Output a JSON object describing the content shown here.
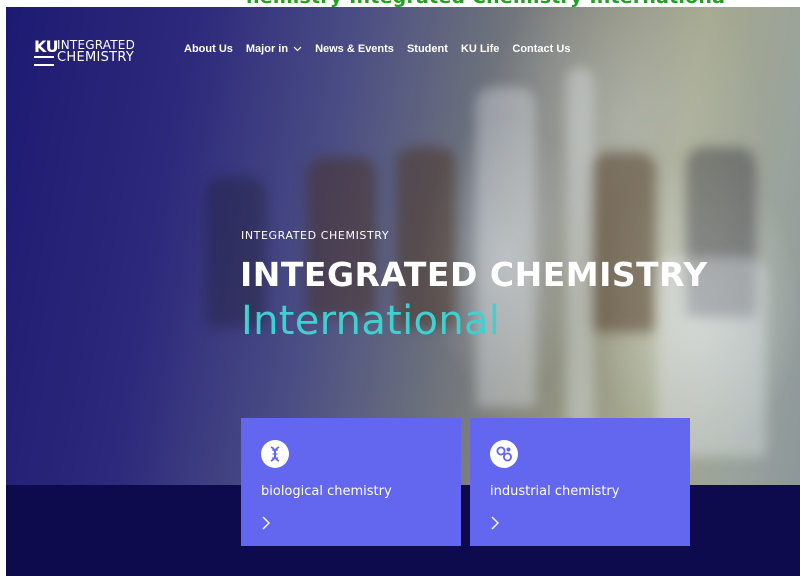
{
  "overlay": {
    "text": "hemistry Integrated Chemistry Internationa"
  },
  "logo": {
    "ku": "KU",
    "line1": "INTEGRATED",
    "line2": "CHEMISTRY"
  },
  "nav": {
    "items": [
      {
        "label": "About Us"
      },
      {
        "label": "Major in",
        "has_dropdown": true
      },
      {
        "label": "News & Events"
      },
      {
        "label": "Student"
      },
      {
        "label": "KU Life"
      },
      {
        "label": "Contact Us"
      }
    ]
  },
  "hero": {
    "eyebrow": "INTEGRATED CHEMISTRY",
    "title": "INTEGRATED CHEMISTRY",
    "subtitle": "International"
  },
  "cards": [
    {
      "label": "biological chemistry",
      "icon": "dna-icon"
    },
    {
      "label": "industrial chemistry",
      "icon": "molecule-icon"
    }
  ],
  "colors": {
    "card_bg": "#6366ee",
    "accent": "#3fd0d0",
    "band": "#0d0b4e",
    "overlay_text": "#1fa31f"
  }
}
